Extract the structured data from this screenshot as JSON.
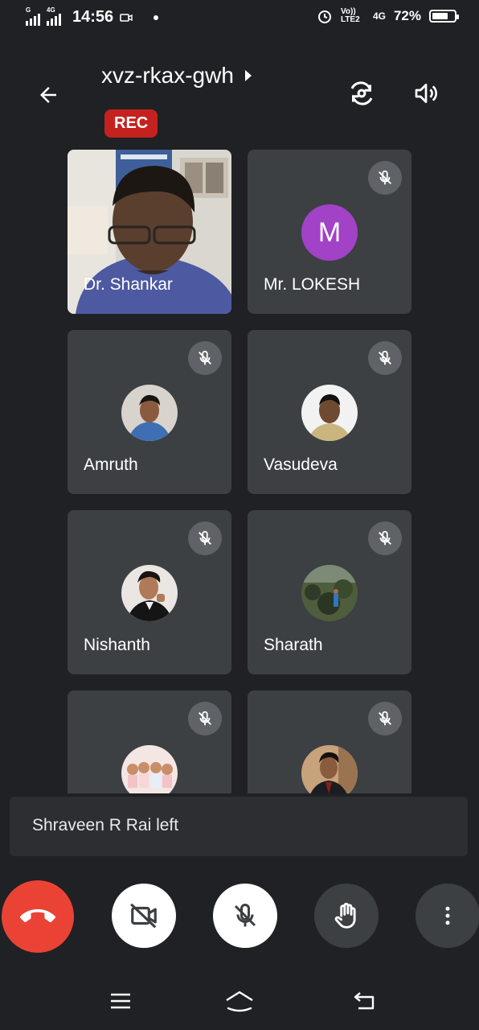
{
  "status_bar": {
    "sim1_label": "G",
    "sim2_label": "4G",
    "time": "14:56",
    "volte_label": "Vo)) LTE2",
    "network": "4G",
    "battery_percent": "72%",
    "battery_level": 0.72
  },
  "header": {
    "meeting_code": "xvz-rkax-gwh",
    "rec_badge": "REC"
  },
  "participants": [
    {
      "name": "Dr. Shankar",
      "muted": false,
      "video": true
    },
    {
      "name": "Mr. LOKESH",
      "muted": true,
      "avatar_letter": "M",
      "avatar_color": "#a142c7"
    },
    {
      "name": "Amruth",
      "muted": true
    },
    {
      "name": "Vasudeva",
      "muted": true
    },
    {
      "name": "Nishanth",
      "muted": true
    },
    {
      "name": "Sharath",
      "muted": true
    },
    {
      "name": "",
      "muted": true
    },
    {
      "name": "",
      "muted": true
    }
  ],
  "toast": {
    "message": "Shraveen R Rai left"
  },
  "controls": {
    "end_call_color": "#ea4335",
    "icons": [
      "end-call-icon",
      "camera-off-icon",
      "mic-off-icon",
      "raise-hand-icon",
      "more-vert-icon"
    ]
  },
  "nav": {
    "icons": [
      "menu-icon",
      "home-icon",
      "back-icon"
    ]
  }
}
